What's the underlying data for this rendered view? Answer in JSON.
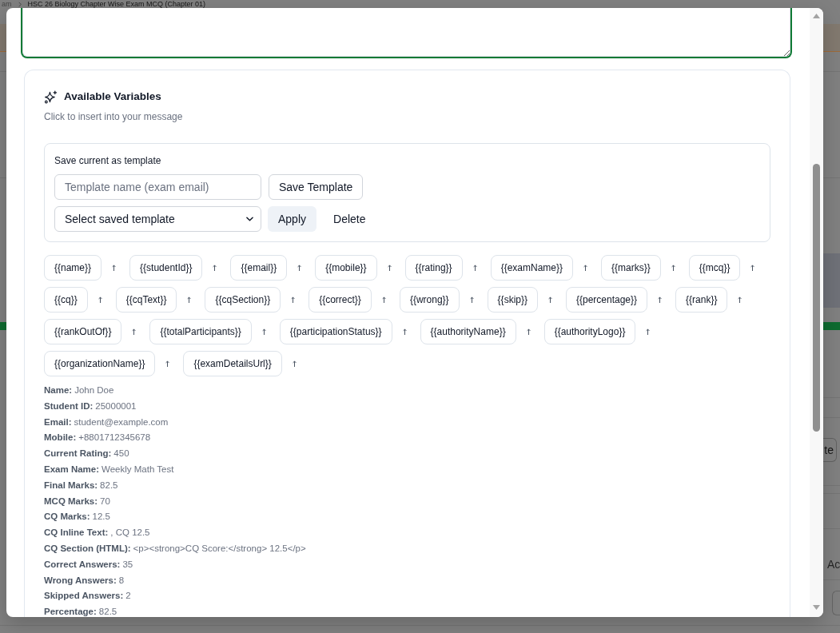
{
  "background_page": {
    "breadcrumb": [
      {
        "kind": "link",
        "label": "am"
      },
      {
        "kind": "current",
        "label": "HSC 26 Biology Chapter Wise Exam MCQ (Chapter 01)"
      }
    ],
    "side_button": {
      "label": "te"
    },
    "side_label": "Ac"
  },
  "message_field": {
    "focused": true
  },
  "variables_panel": {
    "title": "Available Variables",
    "subtitle": "Click to insert into your message",
    "template_form": {
      "heading": "Save current as template",
      "name_field": {
        "placeholder": "Template name (exam email)"
      },
      "save_button": {
        "label": "Save Template"
      },
      "template_select": {
        "value": "Select saved template"
      },
      "apply_button": {
        "label": "Apply"
      },
      "delete_button": {
        "label": "Delete"
      }
    },
    "variables": [
      "{{name}}",
      "{{studentId}}",
      "{{email}}",
      "{{mobile}}",
      "{{rating}}",
      "{{examName}}",
      "{{marks}}",
      "{{mcq}}",
      "{{cq}}",
      "{{cqText}}",
      "{{cqSection}}",
      "{{correct}}",
      "{{wrong}}",
      "{{skip}}",
      "{{percentage}}",
      "{{rank}}",
      "{{rankOutOf}}",
      "{{totalParticipants}}",
      "{{participationStatus}}",
      "{{authorityName}}",
      "{{authorityLogo}}",
      "{{organizationName}}",
      "{{examDetailsUrl}}"
    ],
    "preview": [
      {
        "label": "Name:",
        "value": "John Doe"
      },
      {
        "label": "Student ID:",
        "value": "25000001"
      },
      {
        "label": "Email:",
        "value": "student@example.com"
      },
      {
        "label": "Mobile:",
        "value": "+8801712345678"
      },
      {
        "label": "Current Rating:",
        "value": "450"
      },
      {
        "label": "Exam Name:",
        "value": "Weekly Math Test"
      },
      {
        "label": "Final Marks:",
        "value": "82.5"
      },
      {
        "label": "MCQ Marks:",
        "value": "70"
      },
      {
        "label": "CQ Marks:",
        "value": "12.5"
      },
      {
        "label": "CQ Inline Text:",
        "value": ", CQ 12.5"
      },
      {
        "label": "CQ Section (HTML):",
        "value": "<p><strong>CQ Score:</strong> 12.5</p>"
      },
      {
        "label": "Correct Answers:",
        "value": "35"
      },
      {
        "label": "Wrong Answers:",
        "value": "8"
      },
      {
        "label": "Skipped Answers:",
        "value": "2"
      },
      {
        "label": "Percentage:",
        "value": "82.5"
      }
    ]
  }
}
